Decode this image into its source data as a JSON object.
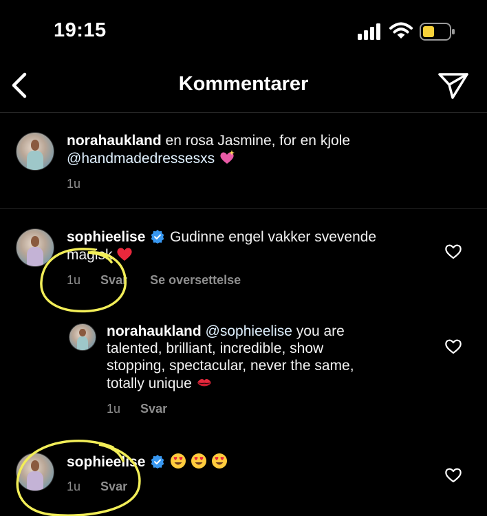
{
  "status_bar": {
    "time": "19:15"
  },
  "header": {
    "title": "Kommentarer"
  },
  "caption": {
    "username": "norahaukland",
    "text_part1": "en rosa Jasmine, for en kjole",
    "mention": "@handmadedressesxs",
    "time": "1u"
  },
  "comments": [
    {
      "username": "sophieelise",
      "text": "Gudinne engel vakker svevende",
      "text_line2": "magisk",
      "time": "1u",
      "reply_label": "Svar",
      "translate_label": "Se oversettelse"
    },
    {
      "username": "norahaukland",
      "mention": "@sophieelise",
      "text_line1": "you are",
      "text_line2": "talented, brilliant, incredible, show",
      "text_line3": "stopping, spectacular, never the same,",
      "text_line4": "totally unique",
      "time": "1u",
      "reply_label": "Svar"
    },
    {
      "username": "sophieelise",
      "time": "1u",
      "reply_label": "Svar"
    }
  ],
  "colors": {
    "background": "#000000",
    "meta_text": "#8e8e8e",
    "verified_badge": "#3897f0",
    "annotation_circle": "#f2ee58",
    "battery_fill": "#f7d13a"
  }
}
